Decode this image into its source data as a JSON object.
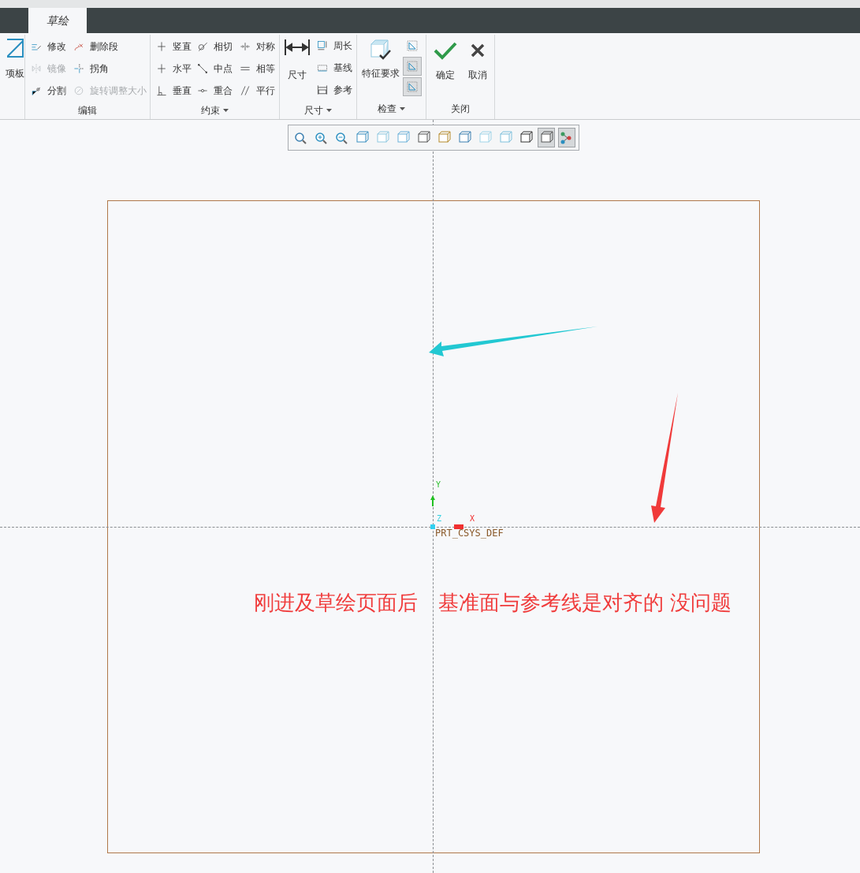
{
  "tabs": [
    {
      "label": "草绘",
      "selected": true
    }
  ],
  "palette": {
    "label": "项板"
  },
  "edit": {
    "label": "编辑",
    "items": [
      {
        "label": "修改",
        "disabled": false
      },
      {
        "label": "删除段",
        "disabled": false
      },
      {
        "label": "镜像",
        "disabled": true
      },
      {
        "label": "拐角",
        "disabled": false
      },
      {
        "label": "分割",
        "disabled": false
      },
      {
        "label": "旋转调整大小",
        "disabled": true
      }
    ]
  },
  "constrain": {
    "label": "约束",
    "dropdown": true,
    "items": [
      {
        "label": "竖直"
      },
      {
        "label": "相切"
      },
      {
        "label": "对称"
      },
      {
        "label": "水平"
      },
      {
        "label": "中点"
      },
      {
        "label": "相等"
      },
      {
        "label": "垂直"
      },
      {
        "label": "重合"
      },
      {
        "label": "平行"
      }
    ]
  },
  "dimension": {
    "label": "尺寸",
    "dropdown": true,
    "main": "尺寸",
    "items": [
      {
        "label": "周长"
      },
      {
        "label": "基线"
      },
      {
        "label": "参考"
      }
    ]
  },
  "inspect": {
    "label": "检查",
    "dropdown": true,
    "main": "特征要求",
    "toggles": [
      {
        "on": false
      },
      {
        "on": true
      },
      {
        "on": true
      }
    ]
  },
  "close": {
    "label": "关闭",
    "buttons": [
      {
        "label": "确定",
        "kind": "ok"
      },
      {
        "label": "取消",
        "kind": "cancel"
      }
    ]
  },
  "view_toolbar": [
    {
      "on": false
    },
    {
      "on": false
    },
    {
      "on": false
    },
    {
      "on": false
    },
    {
      "on": false
    },
    {
      "on": false
    },
    {
      "on": false
    },
    {
      "on": false
    },
    {
      "on": false
    },
    {
      "on": false
    },
    {
      "on": false
    },
    {
      "on": false
    },
    {
      "on": true
    },
    {
      "on": true
    }
  ],
  "canvas": {
    "csys": {
      "y": "Y",
      "z": "Z",
      "x": "X",
      "name": "PRT_CSYS_DEF"
    },
    "note": "刚进及草绘页面后　基准面与参考线是对齐的 没问题"
  }
}
